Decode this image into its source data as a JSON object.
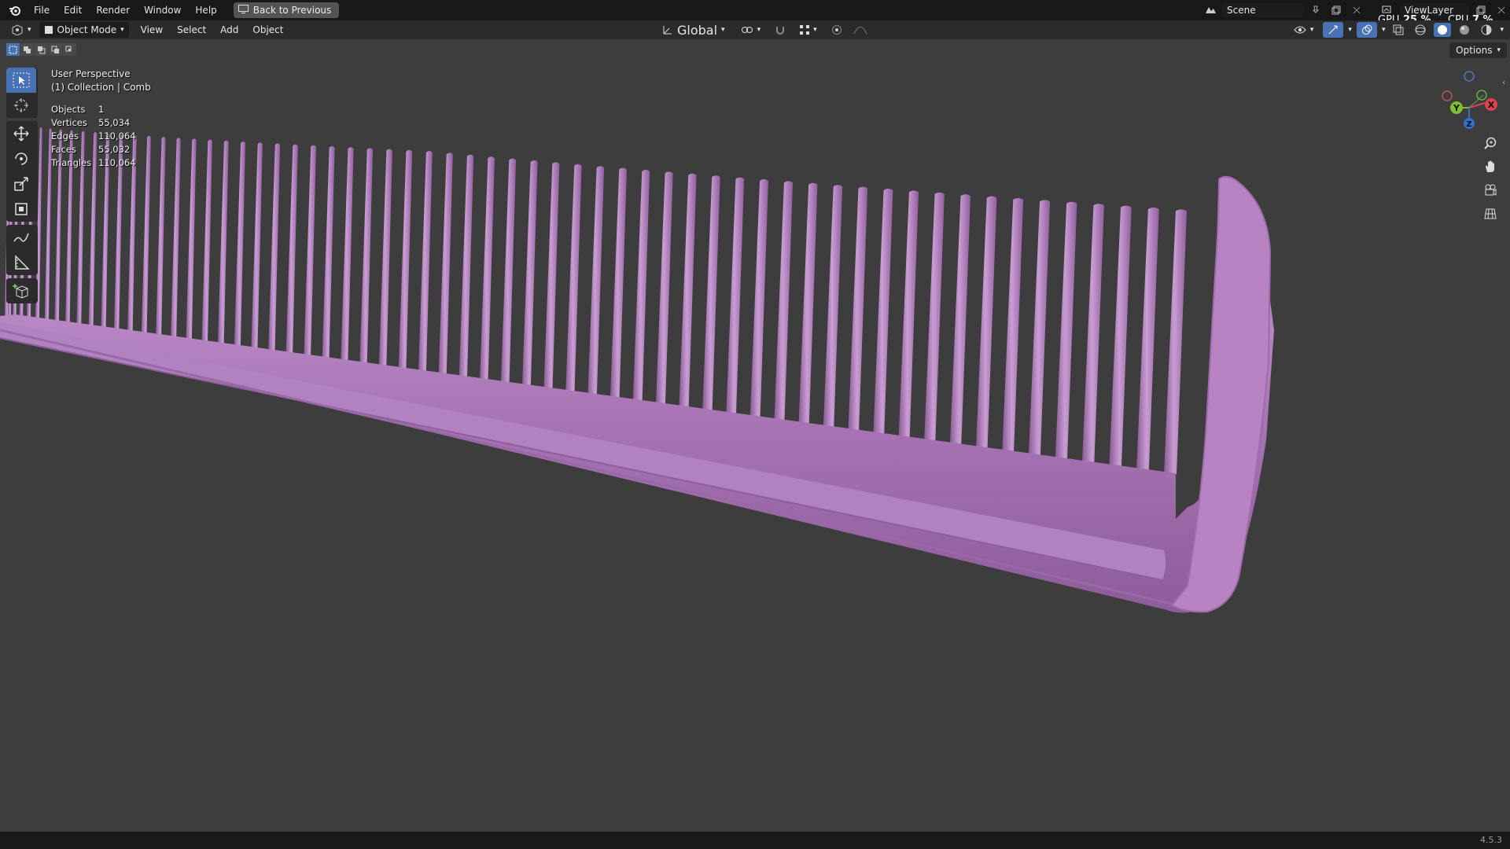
{
  "topbar": {
    "menus": [
      "File",
      "Edit",
      "Render",
      "Window",
      "Help"
    ],
    "back_button": "Back to Previous",
    "scene": "Scene",
    "view_layer": "ViewLayer",
    "gpu_label": "GPU",
    "gpu_value": "25 %",
    "cpu_label": "CPU",
    "cpu_value": "7 %"
  },
  "header": {
    "mode": "Object Mode",
    "menus": [
      "View",
      "Select",
      "Add",
      "Object"
    ],
    "transform_orientation": "Global",
    "options_label": "Options"
  },
  "viewport": {
    "view_name": "User Perspective",
    "collection_line": "(1) Collection | Comb",
    "stats": [
      {
        "label": "Objects",
        "value": "1"
      },
      {
        "label": "Vertices",
        "value": "55,034"
      },
      {
        "label": "Edges",
        "value": "110,064"
      },
      {
        "label": "Faces",
        "value": "55,032"
      },
      {
        "label": "Triangles",
        "value": "110,064"
      }
    ],
    "gizmo_axes": {
      "x": "X",
      "y": "Y",
      "z": "Z"
    },
    "object_color": "#b07bbf"
  },
  "statusbar": {
    "version": "4.5.3"
  }
}
